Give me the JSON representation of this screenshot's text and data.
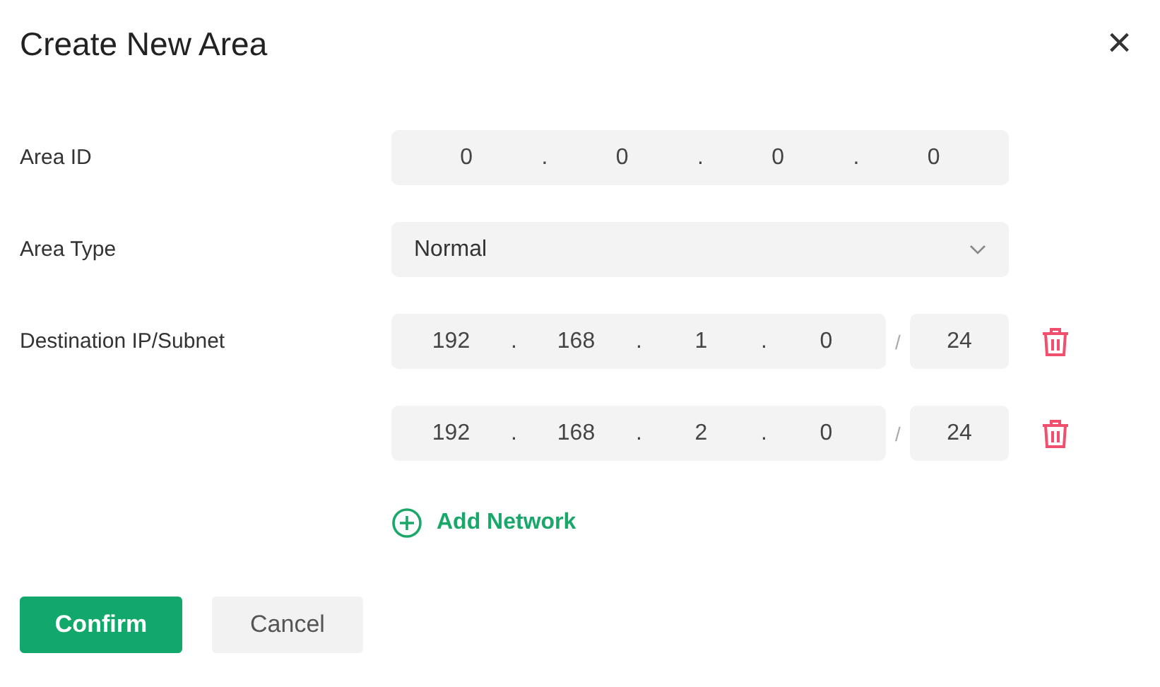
{
  "dialog": {
    "title": "Create New Area",
    "close": "×"
  },
  "area_id": {
    "label": "Area ID",
    "octets": [
      "0",
      "0",
      "0",
      "0"
    ],
    "dots": [
      ".",
      ".",
      "."
    ]
  },
  "area_type": {
    "label": "Area Type",
    "value": "Normal"
  },
  "destinations": {
    "label": "Destination IP/Subnet",
    "separator": "/",
    "rows": [
      {
        "octets": [
          "192",
          "168",
          "1",
          "0"
        ],
        "dots": [
          ".",
          ".",
          "."
        ],
        "prefix": "24"
      },
      {
        "octets": [
          "192",
          "168",
          "2",
          "0"
        ],
        "dots": [
          ".",
          ".",
          "."
        ],
        "prefix": "24"
      }
    ]
  },
  "add_network": {
    "label": "Add Network"
  },
  "buttons": [
    {
      "label": "Confirm",
      "kind": "primary"
    },
    {
      "label": "Cancel",
      "kind": "secondary"
    }
  ]
}
